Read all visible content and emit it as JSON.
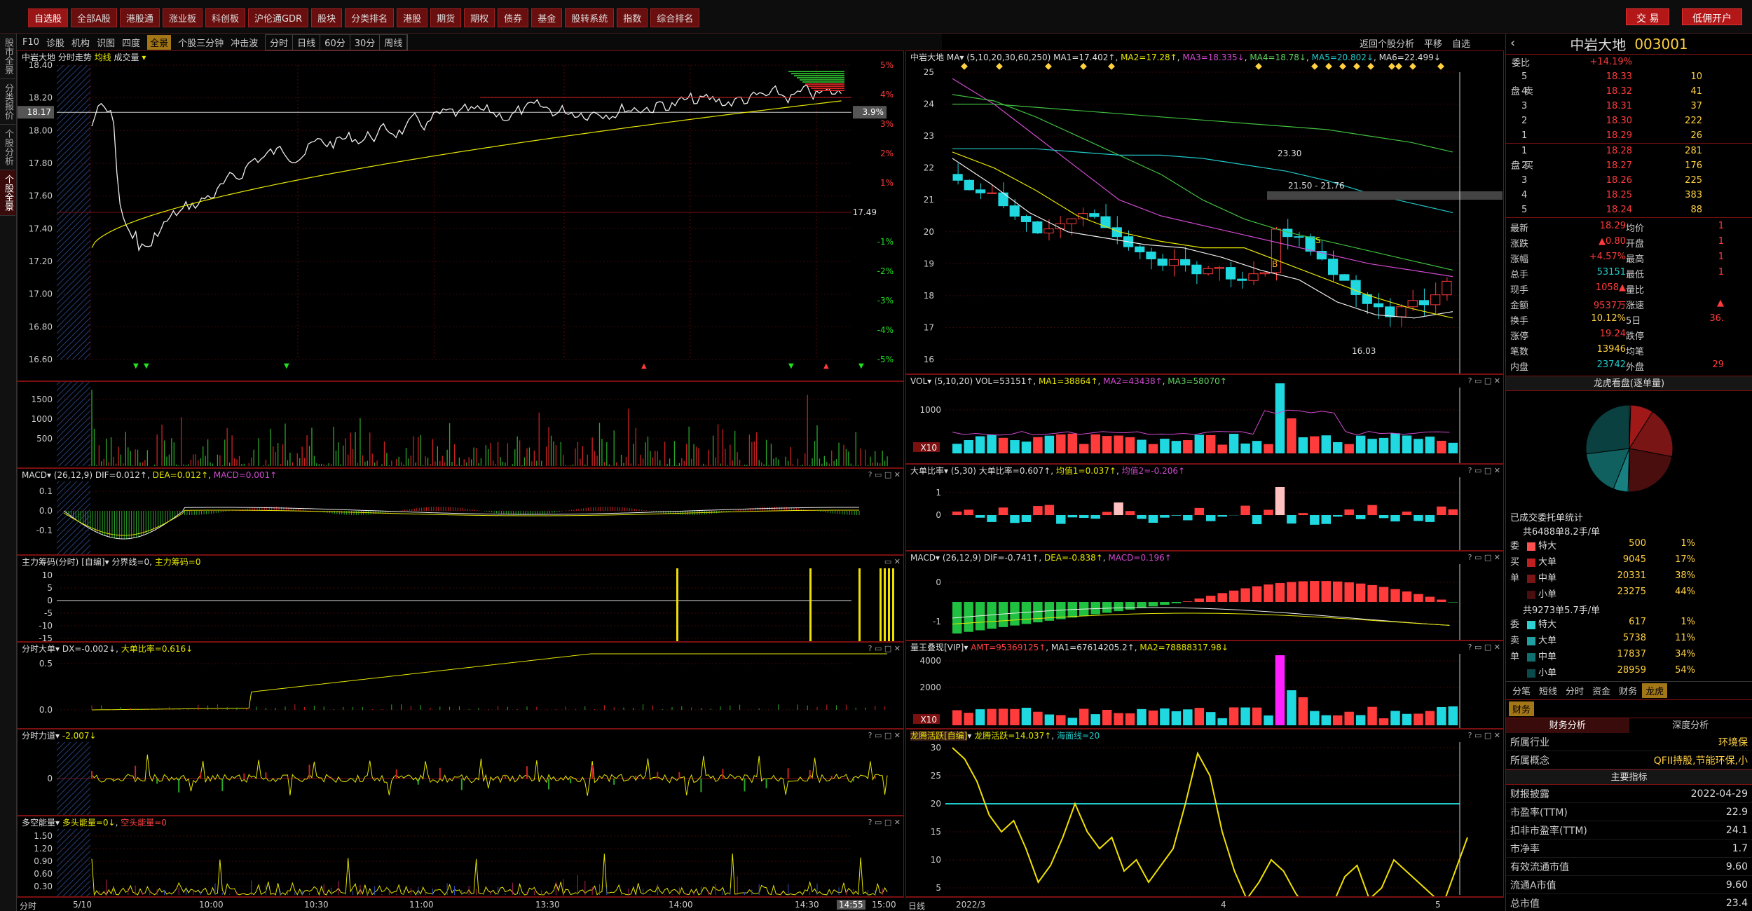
{
  "topbar": {
    "menu": [
      "自选股",
      "全部A股",
      "港股通",
      "涨业板",
      "科创板",
      "沪伦通GDR",
      "股块",
      "分类排名",
      "港股",
      "期货",
      "期权",
      "债券",
      "基金",
      "股转系统",
      "指数",
      "综合排名"
    ],
    "active": 0,
    "btn_trade": "交 易",
    "btn_open": "低佣开户"
  },
  "lefttabs": [
    "股市全景",
    "分类报价",
    "个股分析",
    "个股全景"
  ],
  "toolbar": {
    "items": [
      "F10",
      "诊股",
      "机构",
      "识图",
      "四度"
    ],
    "active": "全景",
    "more": [
      "个股三分钟",
      "冲击波"
    ],
    "periods": [
      "分时",
      "日线",
      "60分",
      "30分",
      "周线"
    ]
  },
  "rtool": {
    "a": "返回个股分析",
    "b": "平移",
    "c": "自选"
  },
  "intraday": {
    "header": {
      "name": "中岩大地",
      "a": "分时走势",
      "b": "均线",
      "c": "成交量"
    },
    "price_ticks": [
      "18.40",
      "18.20",
      "18.00",
      "17.80",
      "17.60",
      "17.40",
      "17.20",
      "17.00",
      "16.80",
      "16.60"
    ],
    "cur_price": "18.17",
    "pct_ticks": [
      "5%",
      "4%",
      "3%",
      "2%",
      "1%",
      "-1%",
      "-2%",
      "-3%",
      "-4%",
      "-5%"
    ],
    "cur_pct": "3.9%",
    "prev_close": "17.49",
    "vol_ticks": [
      "1500",
      "1000",
      "500"
    ],
    "macd_head": {
      "name": "MACD",
      "p": "(26,12,9)",
      "dif": "DIF=0.012↑",
      "dea": "DEA=0.012↑",
      "macd": "MACD=0.001↑"
    },
    "macd_ticks": [
      "0.1",
      "0.0",
      "-0.1"
    ],
    "zl_head": {
      "name": "主力筹码(分时)",
      "t": "[自编]",
      "a": "分界线=0",
      "b": "主力筹码=0"
    },
    "zl_ticks": [
      "10",
      "5",
      "0",
      "-5",
      "-10",
      "-15"
    ],
    "dd_head": {
      "name": "分时大单",
      "a": "DX=-0.002↓",
      "b": "大单比率=0.616↓"
    },
    "dd_ticks": [
      "0.5",
      "0.0"
    ],
    "ld_head": {
      "name": "分时力道",
      "a": "-2.007↓"
    },
    "ld_ticks": [
      "0"
    ],
    "dk_head": {
      "name": "多空能量",
      "a": "多头能量=0↓",
      "b": "空头能量=0"
    },
    "dk_ticks": [
      "1.50",
      "1.20",
      "0.90",
      "0.60",
      "0.30"
    ],
    "time_ticks": [
      "5/10",
      "10:00",
      "10:30",
      "11:00",
      "13:30",
      "14:00",
      "14:30",
      "14:55",
      "15:00"
    ],
    "tlabel": "分时"
  },
  "kline": {
    "header": {
      "name": "中岩大地",
      "ma": "MA",
      "p": "(5,10,20,30,60,250)",
      "m1": "MA1=17.402↑",
      "m2": "MA2=17.28↑",
      "m3": "MA3=18.335↓",
      "m4": "MA4=18.78↓",
      "m5": "MA5=20.802↓",
      "m6": "MA6=22.499↓"
    },
    "price_ticks": [
      "25",
      "24",
      "23",
      "22",
      "21",
      "20",
      "19",
      "18",
      "17",
      "16"
    ],
    "hi": "23.30",
    "range": "21.50 - 21.76",
    "lo": "16.03",
    "b_mark": "B",
    "s_mark": "S",
    "vol_head": {
      "name": "VOL",
      "p": "(5,10,20)",
      "a": "VOL=53151↑",
      "b": "MA1=38864↑",
      "c": "MA2=43438↑",
      "d": "MA3=58070↑"
    },
    "vol_ticks": [
      "1000"
    ],
    "vol_unit": "X10",
    "dd_head": {
      "name": "大单比率",
      "p": "(5,30)",
      "a": "大单比率=0.607↑",
      "b": "均值1=0.037↑",
      "c": "均值2=-0.206↑"
    },
    "dd_ticks": [
      "1",
      "0"
    ],
    "macd_head": {
      "name": "MACD",
      "p": "(26,12,9)",
      "a": "DIF=-0.741↑",
      "b": "DEA=-0.838↑",
      "c": "MACD=0.196↑"
    },
    "macd_ticks": [
      "0",
      "-1"
    ],
    "lw_head": {
      "name": "量王叠现[VIP]",
      "a": "AMT=95369125↑",
      "b": "MA1=67614205.2↑",
      "c": "MA2=78888317.98↓"
    },
    "lw_ticks": [
      "4000",
      "2000"
    ],
    "lw_unit": "X10",
    "lt_head": {
      "name": "龙腾活跃[自编]",
      "a": "龙腾活跃=14.037↑",
      "b": "海面线=20"
    },
    "lt_ticks": [
      "30",
      "25",
      "20",
      "15",
      "10",
      "5"
    ],
    "time_ticks": [
      "2022/3",
      "4",
      "5"
    ],
    "tlabel": "日线"
  },
  "side": {
    "name": "中岩大地",
    "code": "003001",
    "weibi": {
      "k": "委比",
      "v": "+14.19%",
      "v2": "281"
    },
    "asks": [
      [
        "5",
        "18.33",
        "10"
      ],
      [
        "4",
        "18.32",
        "41"
      ],
      [
        "3",
        "18.31",
        "37"
      ],
      [
        "2",
        "18.30",
        "222"
      ],
      [
        "1",
        "18.29",
        "26"
      ]
    ],
    "bids": [
      [
        "1",
        "18.28",
        "281"
      ],
      [
        "2",
        "18.27",
        "176"
      ],
      [
        "3",
        "18.26",
        "225"
      ],
      [
        "4",
        "18.25",
        "383"
      ],
      [
        "5",
        "18.24",
        "88"
      ]
    ],
    "sell_label": "卖盘",
    "buy_label": "买盘",
    "info": [
      [
        "最新",
        "18.29",
        "均价",
        "1"
      ],
      [
        "涨跌",
        "▲0.80",
        "开盘",
        "1"
      ],
      [
        "涨幅",
        "+4.57%",
        "最高",
        "1"
      ],
      [
        "总手",
        "53151",
        "最低",
        "1"
      ],
      [
        "现手",
        "1058▲",
        "量比",
        ""
      ],
      [
        "金额",
        "9537万",
        "涨速",
        "▲"
      ],
      [
        "换手",
        "10.12%",
        "5日",
        "36."
      ],
      [
        "涨停",
        "19.24",
        "跌停",
        ""
      ],
      [
        "笔数",
        "13946",
        "均笔",
        ""
      ],
      [
        "内盘",
        "23742",
        "外盘",
        "29"
      ]
    ],
    "pie_title": "龙虎看盘(逐单量)",
    "pie": [
      {
        "name": "买特大",
        "value": 1,
        "color": "#c02020"
      },
      {
        "name": "买大单",
        "value": 17,
        "color": "#a01818"
      },
      {
        "name": "买中单",
        "value": 38,
        "color": "#7a1515"
      },
      {
        "name": "买小单",
        "value": 44,
        "color": "#4a0e0e"
      },
      {
        "name": "卖特大",
        "value": 1,
        "color": "#20a0a0"
      },
      {
        "name": "卖大单",
        "value": 11,
        "color": "#188080"
      },
      {
        "name": "卖中单",
        "value": 34,
        "color": "#106060"
      },
      {
        "name": "卖小单",
        "value": 54,
        "color": "#0a4040"
      }
    ],
    "ord_title": "已成交委托单统计",
    "buy_total": "共6488单8.2手/单",
    "buy": [
      [
        "特大",
        "500",
        "1%"
      ],
      [
        "大单",
        "9045",
        "17%"
      ],
      [
        "中单",
        "20331",
        "38%"
      ],
      [
        "小单",
        "23275",
        "44%"
      ]
    ],
    "sell_total": "共9273单5.7手/单",
    "sell": [
      [
        "特大",
        "617",
        "1%"
      ],
      [
        "大单",
        "5738",
        "11%"
      ],
      [
        "中单",
        "17837",
        "34%"
      ],
      [
        "小单",
        "28959",
        "54%"
      ]
    ],
    "buy_side": [
      "委",
      "买",
      "单"
    ],
    "sell_side": [
      "委",
      "卖",
      "单"
    ],
    "tabs": [
      "分笔",
      "短线",
      "分时",
      "资金",
      "财务",
      "龙虎"
    ],
    "tab_on": "龙虎",
    "fin_tab": "财务",
    "fin_sub": [
      "财务分析",
      "深度分析"
    ],
    "industry": [
      "所属行业",
      "环境保"
    ],
    "concept": [
      "所属概念",
      "QFII持股,节能环保,小"
    ],
    "main_idx": "主要指标",
    "kvs": [
      [
        "财报披露",
        "2022-04-29"
      ],
      [
        "市盈率(TTM)",
        "22.9"
      ],
      [
        "扣非市盈率(TTM)",
        "24.1"
      ],
      [
        "市净率",
        "1.7"
      ],
      [
        "有效流通市值",
        "9.60"
      ],
      [
        "流通A市值",
        "9.60"
      ],
      [
        "总市值",
        "23.4"
      ]
    ]
  }
}
